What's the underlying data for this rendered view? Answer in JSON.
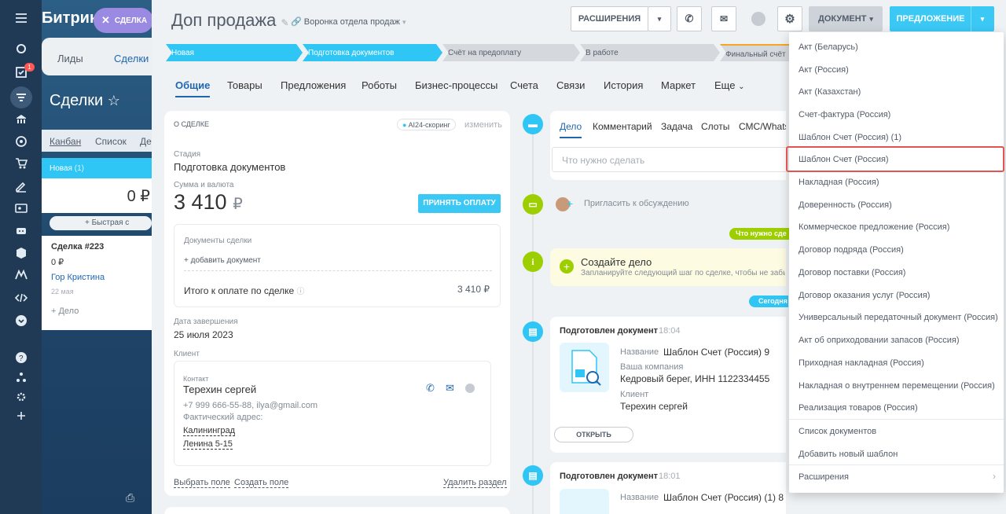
{
  "behind": {
    "logo": "Битрик",
    "tabs": [
      "Лиды",
      "Сделки"
    ],
    "title": "Сделки",
    "views": [
      "Канбан",
      "Список",
      "Де"
    ],
    "column": {
      "name": "Новая",
      "count": "(1)",
      "sum": "0 ₽",
      "quick": "+ Быстрая с"
    },
    "card": {
      "title": "Сделка #223",
      "sum": "0 ₽",
      "contact": "Гор Кристина",
      "date": "22 мая",
      "add": "+ Дело"
    },
    "badge": "1"
  },
  "close_tab": "СДЕЛКА",
  "header": {
    "title": "Доп продажа",
    "funnel": "Воронка отдела продаж",
    "btn_ext": "РАСШИРЕНИЯ",
    "btn_doc": "ДОКУМЕНТ",
    "btn_offer": "ПРЕДЛОЖЕНИЕ"
  },
  "stages": [
    {
      "label": "Новая",
      "color": "#2fc6f6"
    },
    {
      "label": "Подготовка документов",
      "color": "#2fc6f6"
    },
    {
      "label": "Счёт на предоплату",
      "color": "#d5d8dc"
    },
    {
      "label": "В работе",
      "color": "#d5d8dc"
    },
    {
      "label": "Финальный счёт",
      "color": "#d5d8dc"
    }
  ],
  "tabs": [
    "Общие",
    "Товары",
    "Предложения",
    "Роботы",
    "Бизнес-процессы",
    "Счета",
    "Связи",
    "История",
    "Маркет",
    "Еще"
  ],
  "about": {
    "section": "О СДЕЛКЕ",
    "scoring": "AI24-скоринг",
    "edit": "изменить",
    "stage_label": "Стадия",
    "stage": "Подготовка документов",
    "sum_label": "Сумма и валюта",
    "sum": "3 410",
    "currency": "₽",
    "pay_btn": "ПРИНЯТЬ ОПЛАТУ",
    "docs_label": "Документы сделки",
    "add_doc": "+ добавить документ",
    "total_label": "Итого к оплате по сделке",
    "total": "3 410 ₽",
    "close_label": "Дата завершения",
    "close_date": "25 июля 2023",
    "client_label": "Клиент",
    "contact_label": "Контакт",
    "contact_name": "Терехин сергей",
    "contact_info": "+7 999 666-55-88, ilya@gmail.com",
    "addr_label": "Фактический адрес:",
    "city": "Калининград",
    "street": "Ленина 5-15",
    "choose": "Выбрать поле",
    "create": "Создать поле",
    "delete": "Удалить раздел"
  },
  "timeline": {
    "tabs": [
      "Дело",
      "Комментарий",
      "Задача",
      "Слоты",
      "СМС/Whats"
    ],
    "todo_placeholder": "Что нужно сделать",
    "invite": "Пригласить к обсуждению",
    "pill_todo": "Что нужно сде",
    "create_title": "Создайте дело",
    "create_sub": "Запланируйте следующий шаг по сделке, чтобы не забы",
    "pill_today": "Сегодня",
    "doc1": {
      "title": "Подготовлен документ",
      "time": "18:04",
      "name_label": "Название",
      "name": "Шаблон Счет (Россия) 9",
      "company_label": "Ваша компания",
      "company": "Кедровый берег, ИНН 1122334455",
      "client_label": "Клиент",
      "client": "Терехин сергей",
      "open": "ОТКРЫТЬ"
    },
    "doc2": {
      "title": "Подготовлен документ",
      "time": "18:01",
      "name_label": "Название",
      "name": "Шаблон Счет (Россия) (1) 8"
    }
  },
  "dropdown": {
    "items": [
      "Акт (Беларусь)",
      "Акт (Россия)",
      "Акт (Казахстан)",
      "Счет-фактура (Россия)",
      "Шаблон Счет (Россия) (1)",
      "Шаблон Счет (Россия)",
      "Накладная (Россия)",
      "Доверенность (Россия)",
      "Коммерческое предложение (Россия)",
      "Договор подряда (Россия)",
      "Договор поставки (Россия)",
      "Договор оказания услуг (Россия)",
      "Универсальный передаточный документ (Россия)",
      "Акт об оприходовании запасов (Россия)",
      "Приходная накладная (Россия)",
      "Накладная о внутреннем перемещении (Россия)",
      "Реализация товаров (Россия)"
    ],
    "extra": [
      "Список документов",
      "Добавить новый шаблон",
      "Расширения"
    ],
    "highlighted": "Шаблон Счет (Россия)"
  }
}
